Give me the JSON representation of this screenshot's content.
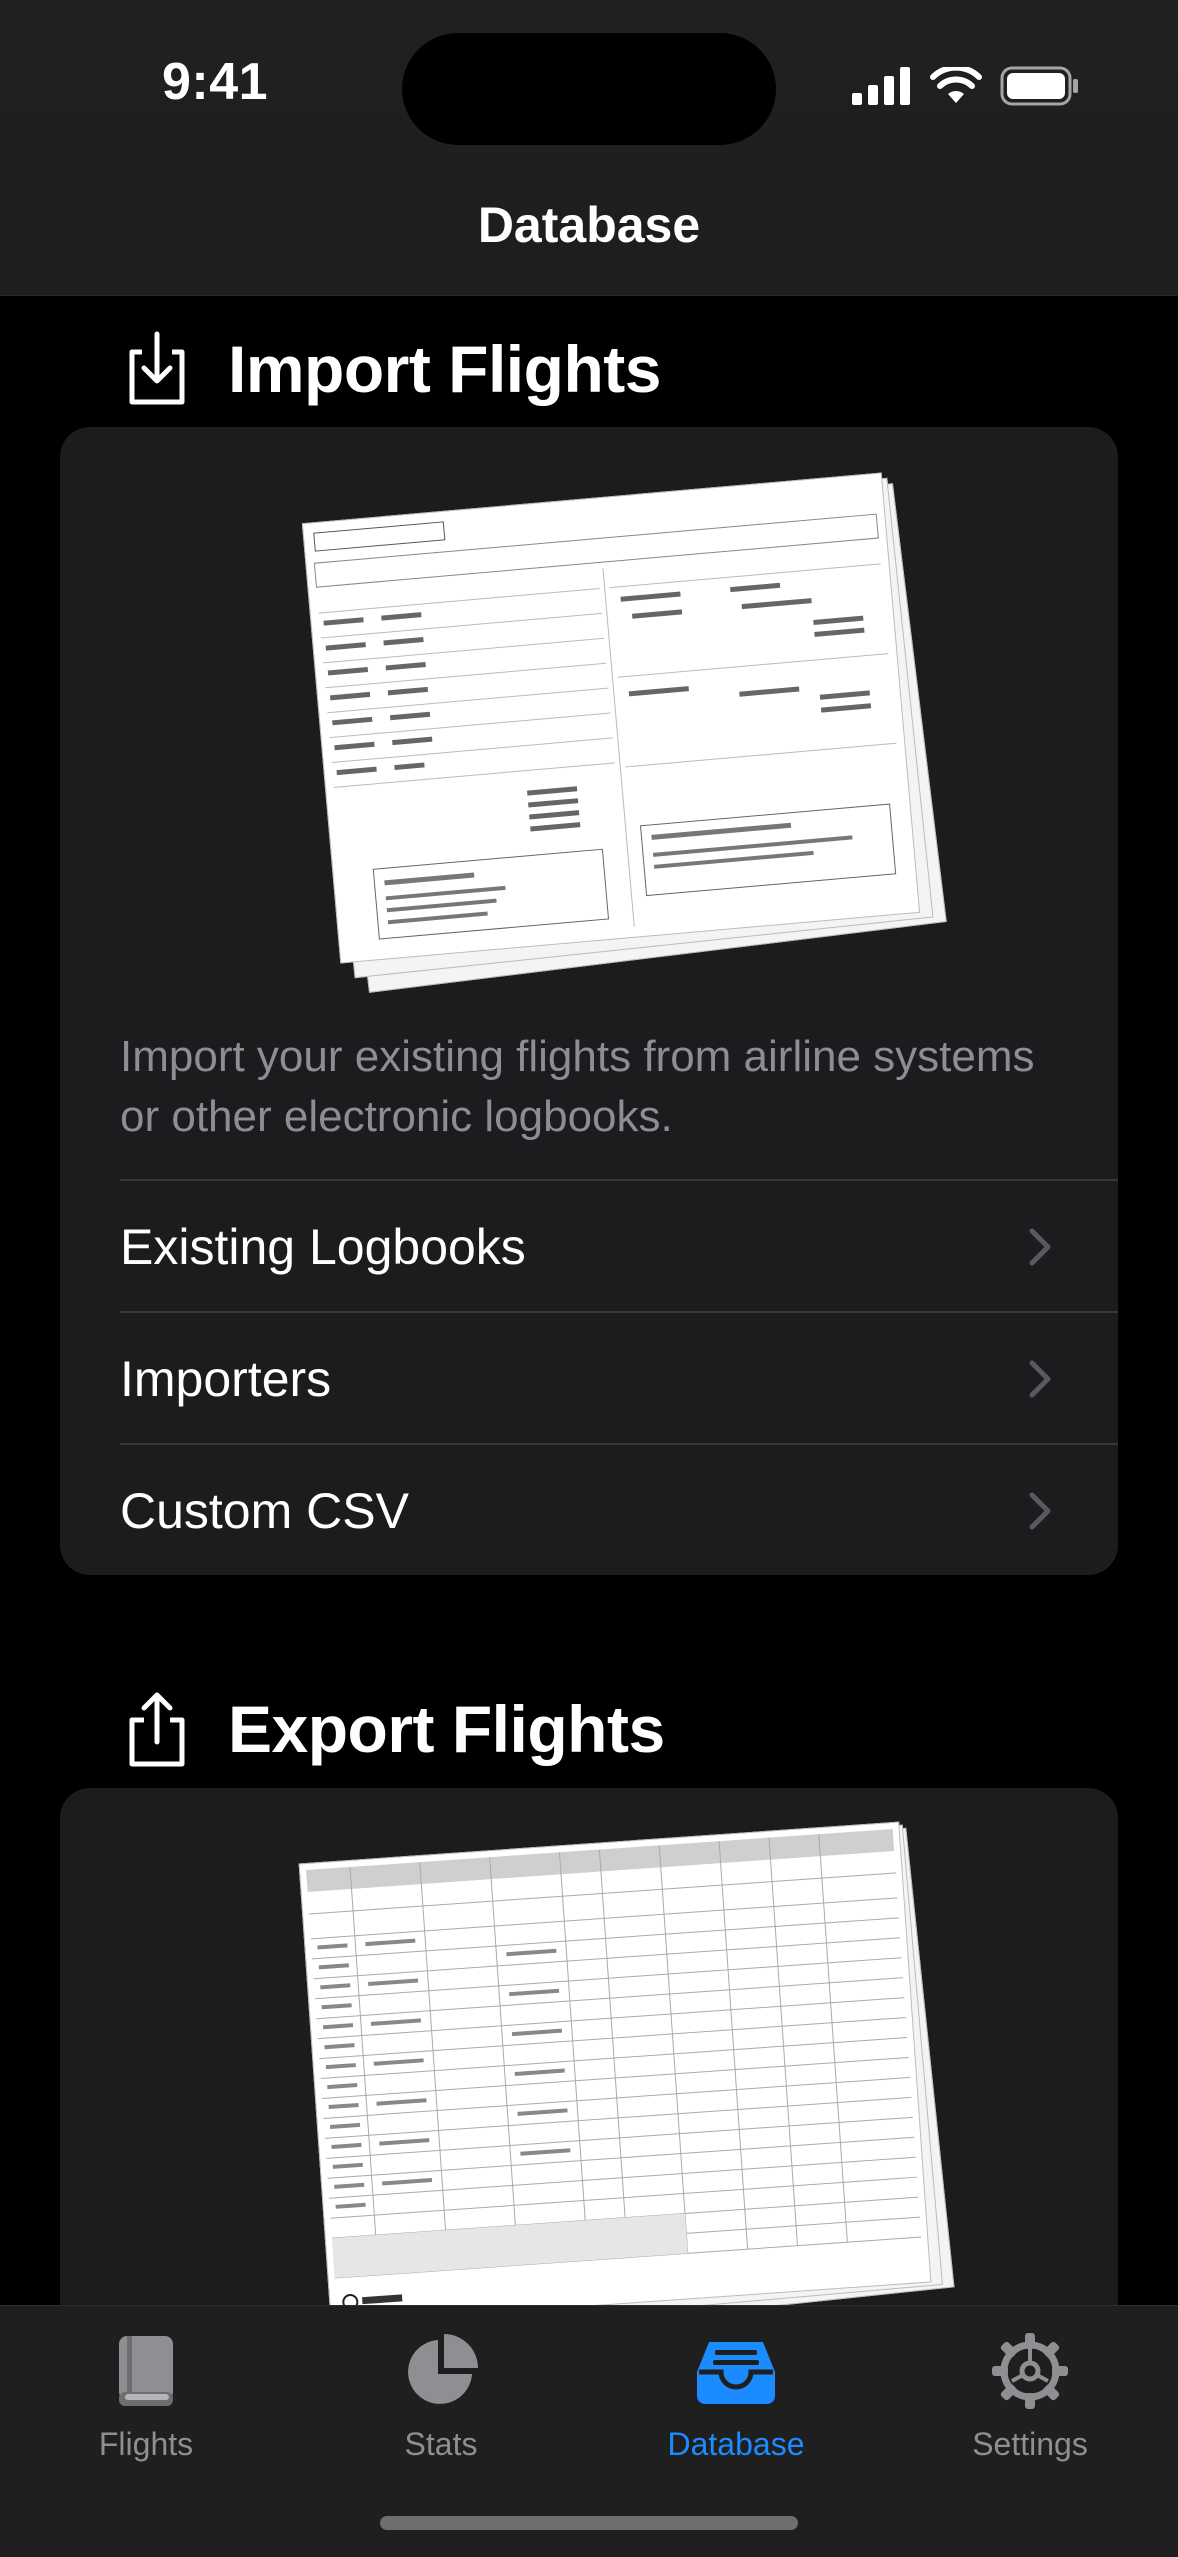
{
  "status_bar": {
    "time": "9:41"
  },
  "nav": {
    "title": "Database"
  },
  "import_section": {
    "title": "Import Flights",
    "description": "Import your existing flights from airline systems or other electronic logbooks.",
    "rows": [
      {
        "label": "Existing Logbooks"
      },
      {
        "label": "Importers"
      },
      {
        "label": "Custom CSV"
      }
    ]
  },
  "export_section": {
    "title": "Export Flights"
  },
  "tabs": [
    {
      "label": "Flights",
      "icon": "book-icon"
    },
    {
      "label": "Stats",
      "icon": "pie-chart-icon"
    },
    {
      "label": "Database",
      "icon": "tray-icon",
      "active": true
    },
    {
      "label": "Settings",
      "icon": "gear-icon"
    }
  ],
  "colors": {
    "accent": "#1a8cff",
    "card": "#1c1c1e",
    "secondary_text": "#8d8d92"
  }
}
